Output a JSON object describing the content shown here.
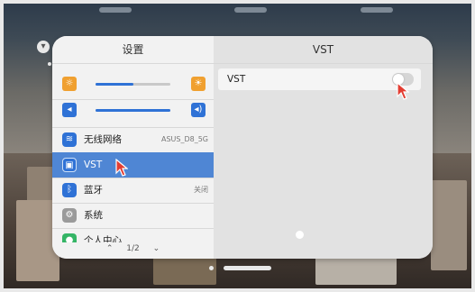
{
  "left_panel": {
    "title": "设置",
    "sliders": [
      {
        "name": "brightness",
        "left_icon": "brightness-low-icon",
        "right_icon": "brightness-high-icon",
        "level": 0.5,
        "icon_color": "#f0a030"
      },
      {
        "name": "volume",
        "left_icon": "volume-low-icon",
        "right_icon": "volume-high-icon",
        "level": 1.0,
        "icon_color": "#2f72d6"
      }
    ],
    "items": [
      {
        "label": "无线网络",
        "value": "ASUS_D8_5G",
        "icon": "wifi-icon",
        "color": "#2f72d6"
      },
      {
        "label": "VST",
        "value": "",
        "icon": "vst-icon",
        "color": "#2f72d6",
        "selected": true
      },
      {
        "label": "蓝牙",
        "value": "关闭",
        "icon": "bluetooth-icon",
        "color": "#2f72d6"
      },
      {
        "label": "系统",
        "value": "",
        "icon": "system-icon",
        "color": "#9a9a9a"
      },
      {
        "label": "个人中心",
        "value": "",
        "icon": "account-icon",
        "color": "#35b566"
      }
    ],
    "pager": {
      "text": "1/2"
    }
  },
  "right_panel": {
    "title": "VST",
    "setting": {
      "label": "VST",
      "enabled": false
    }
  }
}
